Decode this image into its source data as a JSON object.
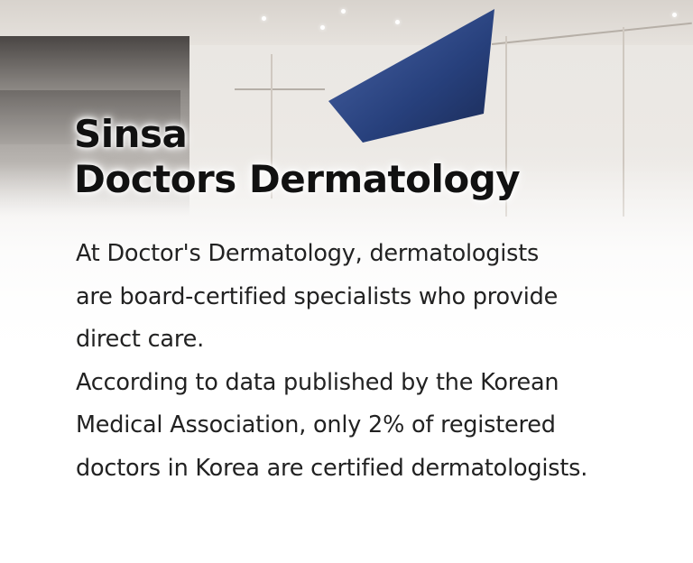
{
  "hero": {
    "title_line1": "Sinsa",
    "title_line2": "Doctors Dermatology",
    "artwork_color": "#2f4a8a"
  },
  "description": {
    "lines": [
      "At Doctor's Dermatology, dermatologists",
      "are board-certified specialists who provide",
      "direct care.",
      "According to data published by the Korean",
      "Medical Association, only 2% of registered",
      "doctors in Korea are certified dermatologists."
    ]
  }
}
